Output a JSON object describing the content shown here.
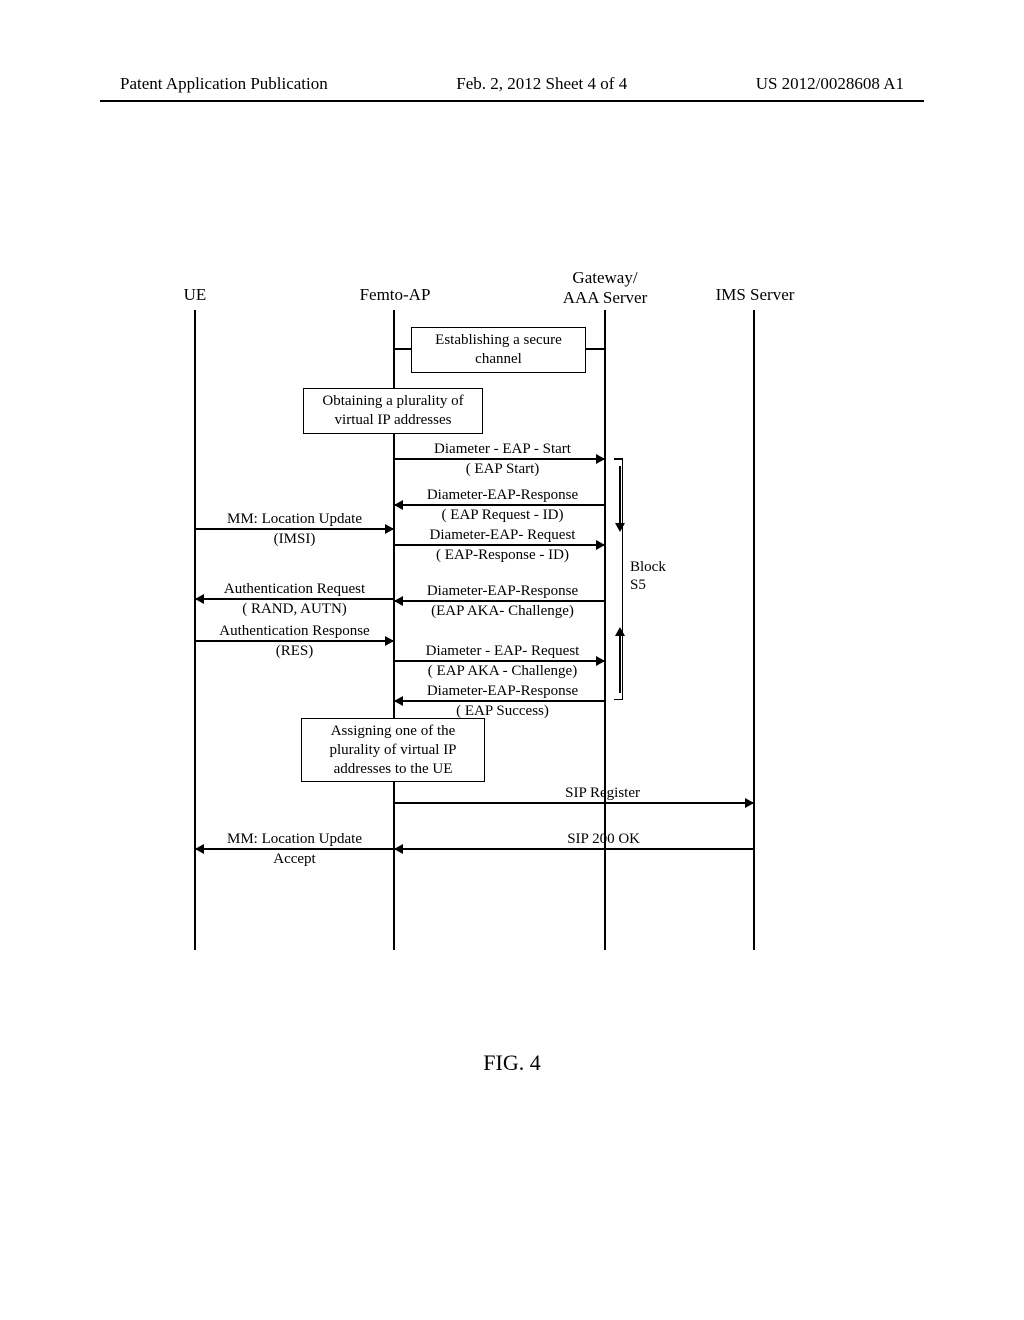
{
  "header": {
    "left": "Patent Application Publication",
    "center": "Feb. 2, 2012   Sheet 4 of 4",
    "right": "US 2012/0028608 A1"
  },
  "actors": {
    "ue": "UE",
    "femto": "Femto-AP",
    "gateway_line1": "Gateway/",
    "gateway_line2": "AAA Server",
    "ims": "IMS Server"
  },
  "boxes": {
    "secure_channel_l1": "Establishing a secure",
    "secure_channel_l2": "channel",
    "obtain_ip_l1": "Obtaining a plurality of",
    "obtain_ip_l2": "virtual IP addresses",
    "assign_ip_l1": "Assigning one of the",
    "assign_ip_l2": "plurality of virtual IP",
    "assign_ip_l3": "addresses to the UE"
  },
  "messages": {
    "eap_start": "Diameter - EAP - Start",
    "eap_start_sub": "( EAP Start)",
    "eap_resp1": "Diameter-EAP-Response",
    "eap_resp1_sub": "( EAP Request - ID)",
    "eap_req1": "Diameter-EAP- Request",
    "eap_req1_sub": "( EAP-Response - ID)",
    "eap_resp2": "Diameter-EAP-Response",
    "eap_resp2_sub": "(EAP AKA- Challenge)",
    "eap_req2": "Diameter - EAP- Request",
    "eap_req2_sub": "( EAP AKA - Challenge)",
    "eap_resp3": "Diameter-EAP-Response",
    "eap_resp3_sub": "( EAP Success)",
    "loc_update": "MM:   Location Update",
    "loc_update_sub": "(IMSI)",
    "auth_req": "Authentication Request",
    "auth_req_sub": "( RAND, AUTN)",
    "auth_resp": "Authentication Response",
    "auth_resp_sub": "(RES)",
    "sip_register": "SIP Register",
    "sip_200ok": "SIP 200 OK",
    "loc_update_accept_l1": "MM:   Location Update",
    "loc_update_accept_l2": "Accept",
    "block_label_l1": "Block",
    "block_label_l2": "S5"
  },
  "figure": "FIG. 4"
}
